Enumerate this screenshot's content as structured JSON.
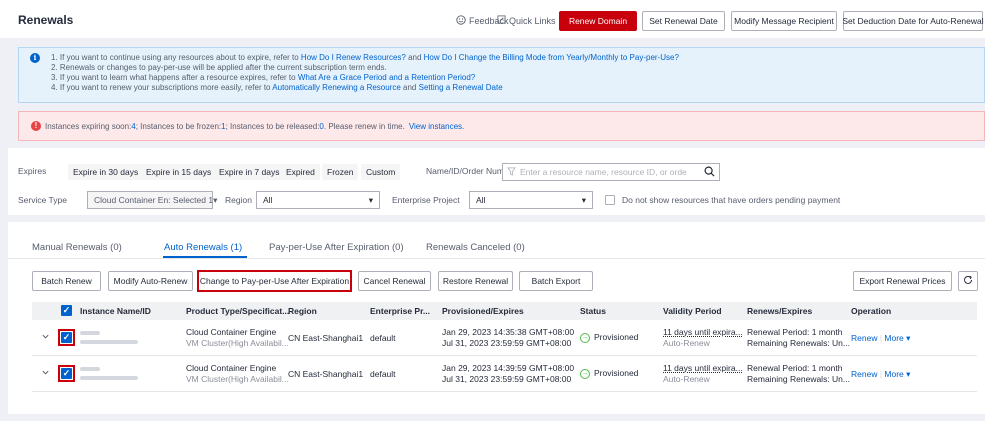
{
  "header": {
    "title": "Renewals",
    "feedback": "Feedback",
    "quick_links": "Quick Links",
    "buttons": {
      "renew_domain": "Renew Domain",
      "set_renewal_date": "Set Renewal Date",
      "modify_message_recipient": "Modify Message Recipient",
      "set_deduction_date": "Set Deduction Date for Auto-Renewal"
    }
  },
  "info": {
    "line1_prefix": "1. If you want to continue using any resources about to expire, refer to ",
    "line1_link1": "How Do I Renew Resources?",
    "line1_mid": " and ",
    "line1_link2": "How Do I Change the Billing Mode from Yearly/Monthly to Pay-per-Use?",
    "line2": "2. Renewals or changes to pay-per-use will be applied after the current subscription term ends.",
    "line3_prefix": "3. If you want to learn what happens after a resource expires, refer to ",
    "line3_link": "What Are a Grace Period and a Retention Period?",
    "line4_prefix": "4. If you want to renew your subscriptions more easily, refer to ",
    "line4_link1": "Automatically Renewing a Resource",
    "line4_mid": " and ",
    "line4_link2": "Setting a Renewal Date"
  },
  "warning": {
    "text1": "Instances expiring soon: ",
    "expiring": "4",
    "text2": " ; Instances to be frozen: ",
    "frozen": "1",
    "text3": " ; Instances to be released: ",
    "released": "0",
    "text4": " . Please renew in time.",
    "link": "View instances."
  },
  "filters": {
    "expires_label": "Expires",
    "chips": [
      "Expire in 30 days",
      "Expire in 15 days",
      "Expire in 7 days",
      "Expired",
      "Frozen",
      "Custom"
    ],
    "name_label": "Name/ID/Order Number",
    "search_placeholder": "Enter a resource name, resource ID, or orde",
    "service_type_label": "Service Type",
    "service_type_value": "Cloud Container En: Selected 1",
    "region_label": "Region",
    "region_value": "All",
    "enterprise_label": "Enterprise Project",
    "enterprise_value": "All",
    "pending_checkbox": "Do not show resources that have orders pending payment"
  },
  "tabs": [
    {
      "label": "Manual Renewals (0)"
    },
    {
      "label": "Auto Renewals (1)"
    },
    {
      "label": "Pay-per-Use After Expiration (0)"
    },
    {
      "label": "Renewals Canceled (0)"
    }
  ],
  "actions": {
    "batch_renew": "Batch Renew",
    "modify_auto_renew": "Modify Auto-Renew",
    "change_to_ppu": "Change to Pay-per-Use After Expiration",
    "cancel_renewal": "Cancel Renewal",
    "restore_renewal": "Restore Renewal",
    "batch_export": "Batch Export",
    "export_prices": "Export Renewal Prices"
  },
  "table": {
    "headers": [
      "Instance Name/ID",
      "Product Type/Specificat...",
      "Region",
      "Enterprise Pr...",
      "Provisioned/Expires",
      "Status",
      "Validity Period",
      "Renews/Expires",
      "Operation"
    ],
    "rows": [
      {
        "product": "Cloud Container Engine",
        "spec": "VM Cluster(High Availabil...",
        "region": "CN East-Shanghai1",
        "enterprise": "default",
        "provisioned": "Jan 29, 2023 14:35:38 GMT+08:00",
        "expires": "Jul 31, 2023 23:59:59 GMT+08:00",
        "status": "Provisioned",
        "validity": "11 days until expira...",
        "validity_sub": "Auto-Renew",
        "renew_period": "Renewal Period: 1 month",
        "remaining": "Remaining Renewals: Un...",
        "op_renew": "Renew",
        "op_more": "More"
      },
      {
        "product": "Cloud Container Engine",
        "spec": "VM Cluster(High Availabil...",
        "region": "CN East-Shanghai1",
        "enterprise": "default",
        "provisioned": "Jan 29, 2023 14:39:59 GMT+08:00",
        "expires": "Jul 31, 2023 23:59:59 GMT+08:00",
        "status": "Provisioned",
        "validity": "11 days until expira...",
        "validity_sub": "Auto-Renew",
        "renew_period": "Renewal Period: 1 month",
        "remaining": "Remaining Renewals: Un...",
        "op_renew": "Renew",
        "op_more": "More"
      }
    ]
  },
  "colors": {
    "accent": "#0062ce",
    "brand_red": "#c7000b",
    "success": "#50b946"
  }
}
